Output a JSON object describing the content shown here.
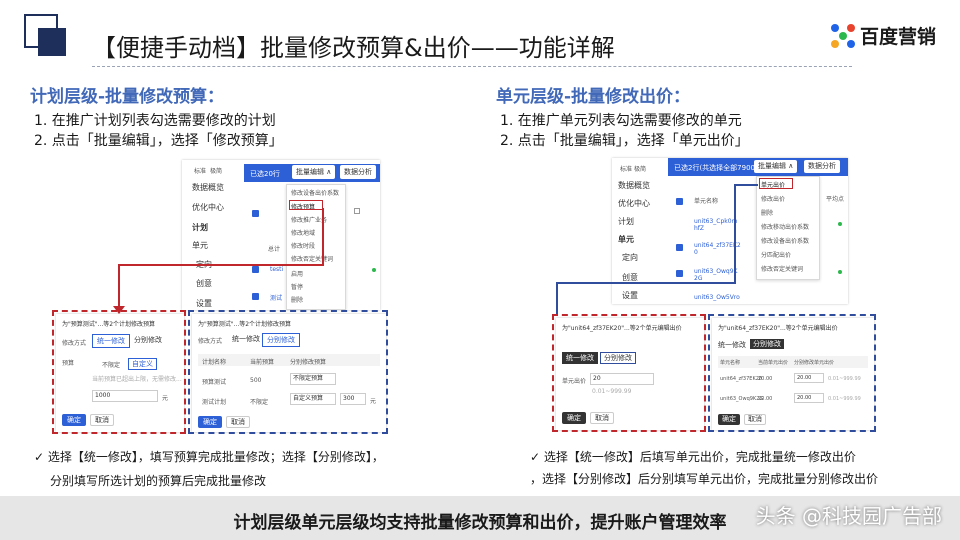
{
  "header": {
    "title": "【便捷手动档】批量修改预算&出价——功能详解",
    "brand": "百度营销",
    "brand_colors": [
      "#1e63e8",
      "#e8432d",
      "#2db84d",
      "#f5a623"
    ]
  },
  "left": {
    "section_title": "计划层级-批量修改预算：",
    "steps": [
      "1.  在推广计划列表勾选需要修改的计划",
      "2.  点击「批量编辑」，选择「修改预算」"
    ],
    "screenshot": {
      "tabs": [
        "标准",
        "极简"
      ],
      "sidebar": [
        "数据概览",
        "优化中心",
        "计划",
        "单元",
        "定向",
        "创意",
        "设置"
      ],
      "selected_label": "已选20行",
      "batch_edit_label": "批量编辑 ∧",
      "data_analysis_label": "数据分析",
      "row_labels": [
        "总计",
        "testi",
        "测试"
      ],
      "menu_items": [
        "修改设备出价系数",
        "修改预算",
        "修改推广业务",
        "修改地域",
        "修改时段",
        "修改否定关键词",
        "启用",
        "暂停",
        "删除"
      ],
      "menu_highlight": "修改预算"
    },
    "dialog_left": {
      "title": "为\"预算测试\"...等2个计划修改预算",
      "method_label": "修改方式",
      "unified_tab": "统一修改",
      "separate_tab": "分别修改",
      "budget_label": "预算",
      "no_limit": "不限定",
      "custom": "自定义",
      "hint": "当前预算已超出上限，无需修改...",
      "value": "1000",
      "unit": "元",
      "ok": "确定",
      "cancel": "取消"
    },
    "dialog_right": {
      "title": "为\"预算测试\"...等2个计划修改预算",
      "method_label": "修改方式",
      "unified_tab": "统一修改",
      "separate_tab": "分别修改",
      "columns": [
        "计划名称",
        "当前预算",
        "分别修改预算"
      ],
      "rows": [
        {
          "name": "预算测试",
          "current": "500",
          "new": "不限定预算"
        },
        {
          "name": "测试计划",
          "current": "不限定",
          "new": "自定义预算",
          "value": "300",
          "unit": "元"
        }
      ],
      "ok": "确定",
      "cancel": "取消"
    },
    "notes": [
      "✓  选择【统一修改】，填写预算完成批量修改；选择【分别修改】，",
      "分别填写所选计划的预算后完成批量修改"
    ]
  },
  "right": {
    "section_title": "单元层级-批量修改出价：",
    "steps": [
      "1.  在推广单元列表勾选需要修改的单元",
      "2.  点击「批量编辑」，选择「单元出价」"
    ],
    "screenshot": {
      "tabs": [
        "标准",
        "极简"
      ],
      "sidebar": [
        "数据概览",
        "优化中心",
        "计划",
        "单元",
        "定向",
        "创意",
        "设置"
      ],
      "selected_label": "已选2行(共选择全部79007行)",
      "batch_edit_label": "批量编辑 ∧",
      "data_analysis_label": "数据分析",
      "col_header": "单元名称",
      "col_right": "平均点",
      "row_labels": [
        "unit63_Cpk0m hfZ",
        "unit64_zf37EK2 0",
        "unit63_Owq9K 2G",
        "unit63_Ow5Vro"
      ],
      "menu_items": [
        "单元出价",
        "修改出价",
        "删除",
        "修改移动出价系数",
        "修改设备出价系数",
        "分匹配出价",
        "修改否定关键词"
      ],
      "menu_highlight": "单元出价"
    },
    "dialog_left": {
      "title": "为\"unit64_zf37EK20\"...等2个单元编辑出价",
      "unified_tab": "统一修改",
      "separate_tab": "分别修改",
      "bid_label": "单元出价",
      "value": "20",
      "range": "0.01~999.99",
      "ok": "确定",
      "cancel": "取消"
    },
    "dialog_right": {
      "title": "为\"unit64_zf37EK20\"...等2个单元编辑出价",
      "unified_tab": "统一修改",
      "separate_tab": "分别修改",
      "columns": [
        "单元名称",
        "当前单元出价",
        "分别修改单元出价"
      ],
      "rows": [
        {
          "name": "unit64_zf37EK20",
          "current": "20.00",
          "new": "20.00",
          "range": "0.01~999.99"
        },
        {
          "name": "unit63_Owq9K2G",
          "current": "20.00",
          "new": "20.00",
          "range": "0.01~999.99"
        }
      ],
      "ok": "确定",
      "cancel": "取消"
    },
    "notes": [
      "✓  选择【统一修改】后填写单元出价，完成批量统一修改出价",
      "，选择【分别修改】后分别填写单元出价，完成批量分别修改出价"
    ]
  },
  "footer": {
    "summary": "计划层级单元层级均支持批量修改预算和出价，提升账户管理效率",
    "watermark": "头条 @科技园广告部"
  }
}
